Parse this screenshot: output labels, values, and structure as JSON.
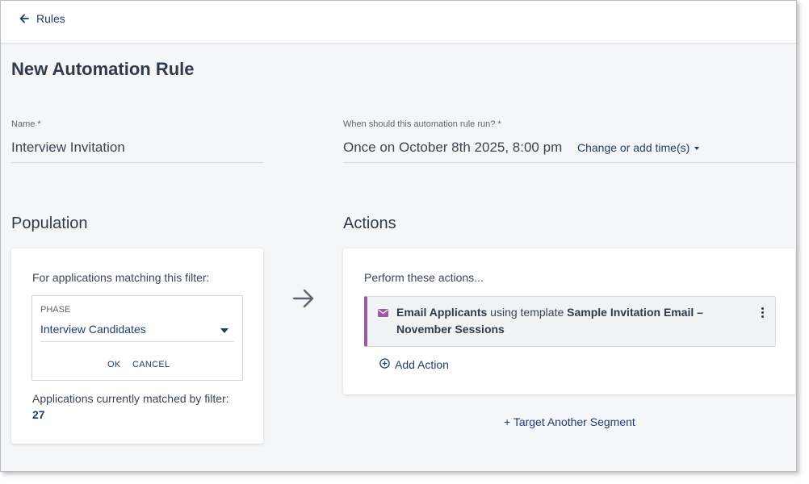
{
  "nav": {
    "back_label": "Rules"
  },
  "page": {
    "title": "New Automation Rule"
  },
  "name_field": {
    "label": "Name *",
    "value": "Interview Invitation"
  },
  "schedule": {
    "label": "When should this automation rule run? *",
    "value": "Once on October 8th 2025, 8:00 pm",
    "change_label": "Change or add time(s)"
  },
  "population": {
    "title": "Population",
    "filter_intro": "For applications matching this filter:",
    "filter_key": "PHASE",
    "filter_value": "Interview Candidates",
    "ok_label": "OK",
    "cancel_label": "CANCEL",
    "matched_label": "Applications currently matched by filter:",
    "matched_count": "27"
  },
  "actions": {
    "title": "Actions",
    "intro": "Perform these actions...",
    "items": [
      {
        "icon": "mail-icon",
        "name": "Email Applicants",
        "connector": " using template ",
        "template": "Sample Invitation Email – November Sessions"
      }
    ],
    "add_label": "Add Action",
    "target_another_label": "+ Target Another Segment"
  },
  "colors": {
    "accent": "#1f3d6b",
    "action_stripe": "#9d59a5",
    "background": "#f5f6f8"
  }
}
